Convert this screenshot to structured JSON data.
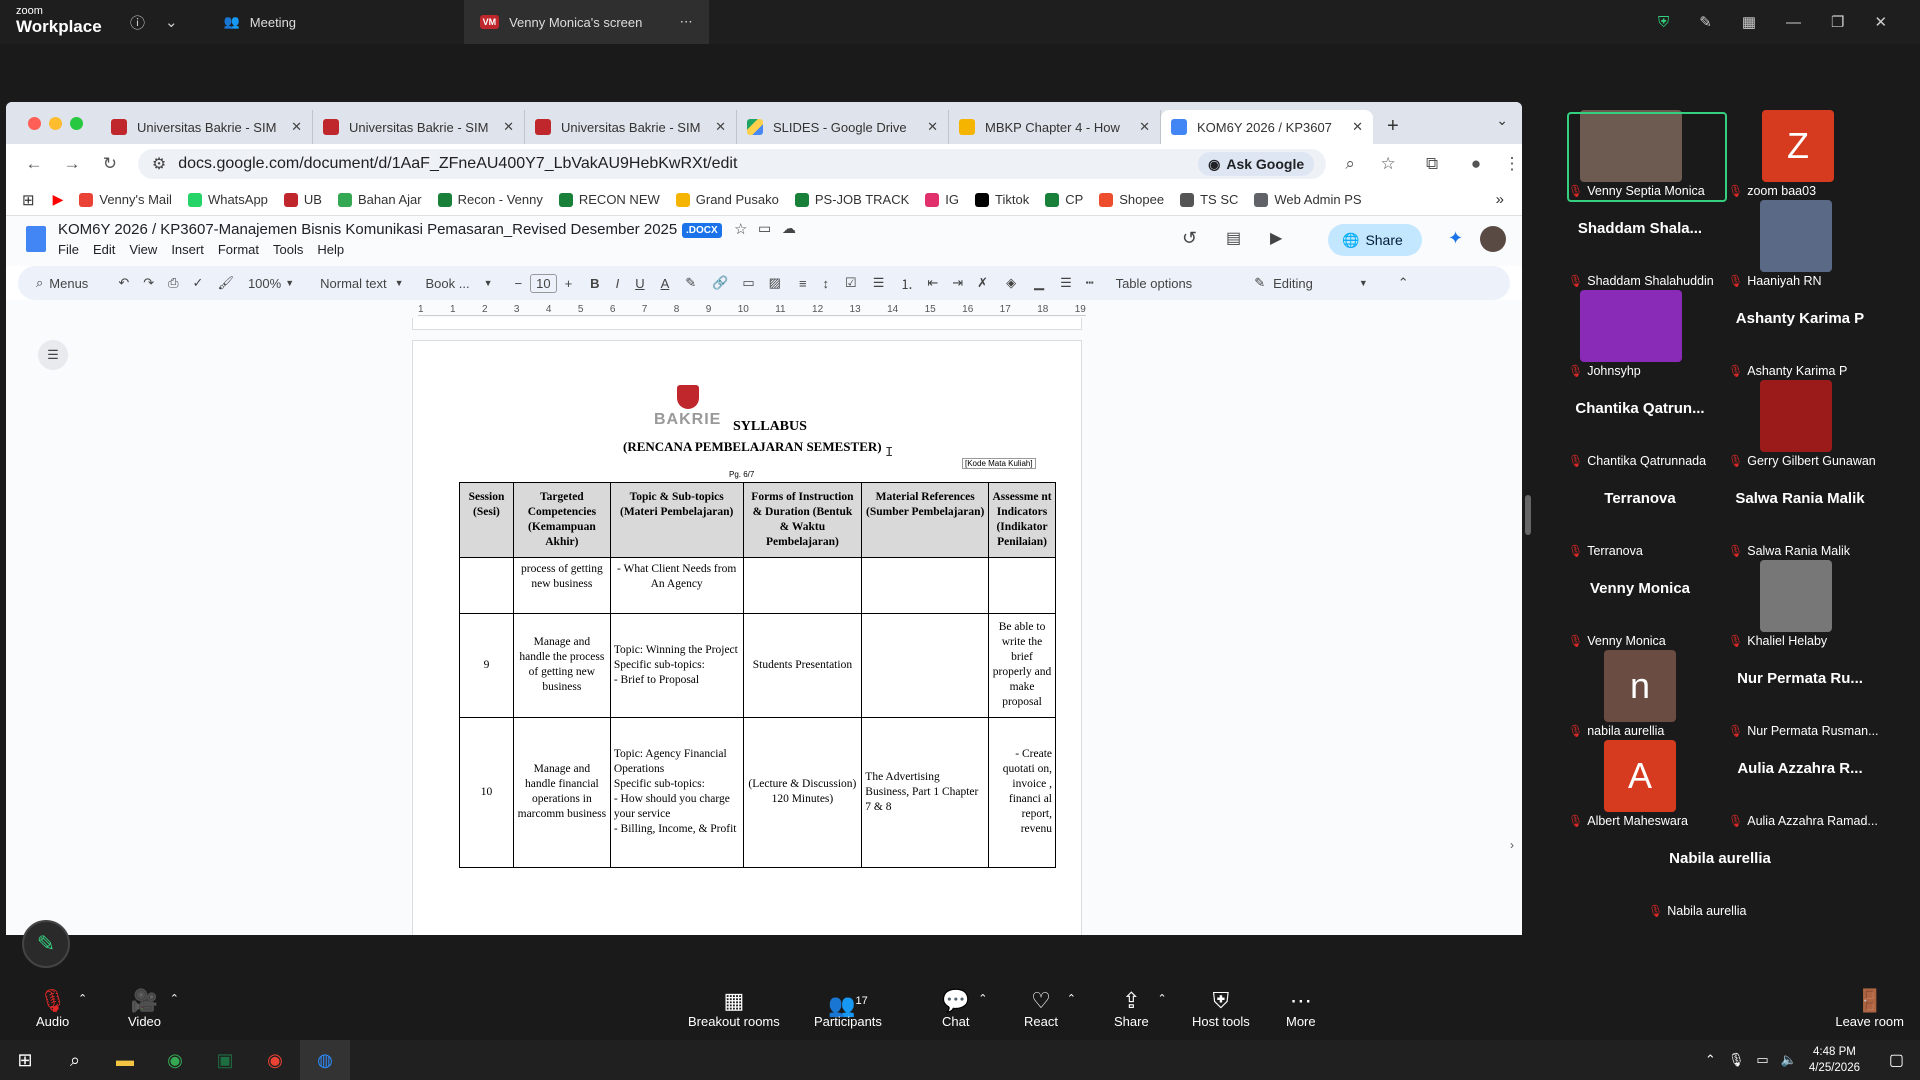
{
  "zoom": {
    "brand_top": "zoom",
    "brand_bottom": "Workplace",
    "meeting_tab": "Meeting",
    "share_tab_badge": "VM",
    "share_tab": "Venny Monica's screen"
  },
  "chrome": {
    "tabs": [
      {
        "title": "Universitas Bakrie - SIM",
        "fav": "ub"
      },
      {
        "title": "Universitas Bakrie - SIM",
        "fav": "ub"
      },
      {
        "title": "Universitas Bakrie - SIM",
        "fav": "ub"
      },
      {
        "title": "SLIDES - Google Drive",
        "fav": "gd"
      },
      {
        "title": "MBKP Chapter 4 - How",
        "fav": "sl"
      },
      {
        "title": "KOM6Y 2026 / KP3607",
        "fav": "doc"
      }
    ],
    "url": "docs.google.com/document/d/1AaF_ZFneAU400Y7_LbVakAU9HebKwRXt/edit",
    "ask_google": "Ask Google",
    "bookmarks": [
      "Venny's Mail",
      "WhatsApp",
      "UB",
      "Bahan Ajar",
      "Recon - Venny",
      "RECON NEW",
      "Grand Pusako",
      "PS-JOB TRACK",
      "IG",
      "Tiktok",
      "CP",
      "Shopee",
      "TS SC",
      "Web Admin PS"
    ],
    "bookmark_colors": [
      "#ea4335",
      "#25d366",
      "#c0272d",
      "#34a853",
      "#188038",
      "#188038",
      "#f4b400",
      "#188038",
      "#e1306c",
      "#000000",
      "#188038",
      "#ee4d2d",
      "#555555",
      "#5f6368"
    ]
  },
  "docs": {
    "title": "KOM6Y 2026 / KP3607-Manajemen Bisnis Komunikasi Pemasaran_Revised Desember 2025",
    "ext": ".DOCX",
    "menu": [
      "File",
      "Edit",
      "View",
      "Insert",
      "Format",
      "Tools",
      "Help"
    ],
    "share": "Share",
    "toolbar": {
      "menus": "Menus",
      "zoom": "100%",
      "style": "Normal text",
      "font": "Book ...",
      "size": "10",
      "table_options": "Table options",
      "editing": "Editing"
    },
    "ruler": [
      "1",
      "1",
      "2",
      "3",
      "4",
      "5",
      "6",
      "7",
      "8",
      "9",
      "10",
      "11",
      "12",
      "13",
      "14",
      "15",
      "16",
      "17",
      "18",
      "19"
    ]
  },
  "syllabus": {
    "logo_text": "BAKRIE",
    "title": "SYLLABUS",
    "subtitle": "(RENCANA PEMBELAJARAN SEMESTER)",
    "code": "[Kode Mata Kuliah]",
    "page": "Pg. 6/7",
    "headers": [
      "Session (Sesi)",
      "Targeted Competencies (Kemampuan Akhir)",
      "Topic & Sub-topics (Materi Pembelajaran)",
      "Forms of Instruction & Duration (Bentuk & Waktu Pembelajaran)",
      "Material References (Sumber Pembelajaran)",
      "Assessme nt Indicators (Indikator Penilaian)"
    ],
    "rows": [
      [
        "",
        "process of getting new business",
        "- What Client Needs from An Agency",
        "",
        "",
        ""
      ],
      [
        "9",
        "Manage and handle the process of getting new business",
        "Topic: Winning the Project\nSpecific sub-topics:\n    - Brief to Proposal",
        "Students Presentation",
        "",
        "Be able to write the brief properly and make proposal"
      ],
      [
        "10",
        "Manage and handle financial operations in marcomm business",
        "Topic: Agency Financial Operations\nSpecific sub-topics:\n    - How should you charge your service\n    - Billing, Income, & Profit",
        "(Lecture & Discussion)\n120 Minutes)",
        "The Advertising Business, Part 1 Chapter 7 & 8",
        "- Create quotati on, invoice , financi al report, revenu"
      ]
    ]
  },
  "participants": [
    {
      "label": "Venny Septia Monica",
      "kind": "photo",
      "color": "#6d5b52"
    },
    {
      "label": "zoom baa03",
      "kind": "avatar",
      "initial": "Z",
      "color": "#d63b1f"
    },
    {
      "name": "Shaddam  Shala...",
      "label": "Shaddam Shalahuddin",
      "kind": "name"
    },
    {
      "label": "Haaniyah RN",
      "kind": "photo",
      "color": "#5a6a86"
    },
    {
      "label": "Johnsyhp",
      "kind": "photo",
      "color": "#8a2bb8"
    },
    {
      "name": "Ashanty Karima P",
      "label": "Ashanty Karima P",
      "kind": "name"
    },
    {
      "name": "Chantika  Qatrun...",
      "label": "Chantika Qatrunnada",
      "kind": "name"
    },
    {
      "label": "Gerry Gilbert Gunawan",
      "kind": "photo",
      "color": "#9b1b1b"
    },
    {
      "name": "Terranova",
      "label": "Terranova",
      "kind": "name"
    },
    {
      "name": "Salwa Rania Malik",
      "label": "Salwa Rania Malik",
      "kind": "name"
    },
    {
      "name": "Venny Monica",
      "label": "Venny Monica",
      "kind": "name"
    },
    {
      "label": "Khaliel Helaby",
      "kind": "photo",
      "color": "#777777"
    },
    {
      "label": "nabila aurellia",
      "kind": "avatar",
      "initial": "n",
      "color": "#6b4c42"
    },
    {
      "name": "Nur Permata Ru...",
      "label": "Nur Permata Rusman...",
      "kind": "name"
    },
    {
      "label": "Albert Maheswara",
      "kind": "avatar",
      "initial": "A",
      "color": "#d63b1f"
    },
    {
      "name": "Aulia Azzahra R...",
      "label": "Aulia Azzahra Ramad...",
      "kind": "name"
    },
    {
      "name": "Nabila aurellia",
      "label": "Nabila aurellia",
      "kind": "name"
    }
  ],
  "controls": {
    "audio": "Audio",
    "video": "Video",
    "breakout": "Breakout rooms",
    "participants": "Participants",
    "participants_count": "17",
    "chat": "Chat",
    "react": "React",
    "share": "Share",
    "host_tools": "Host tools",
    "more": "More",
    "leave": "Leave room"
  },
  "taskbar": {
    "time": "4:48 PM",
    "date": "4/25/2026"
  }
}
